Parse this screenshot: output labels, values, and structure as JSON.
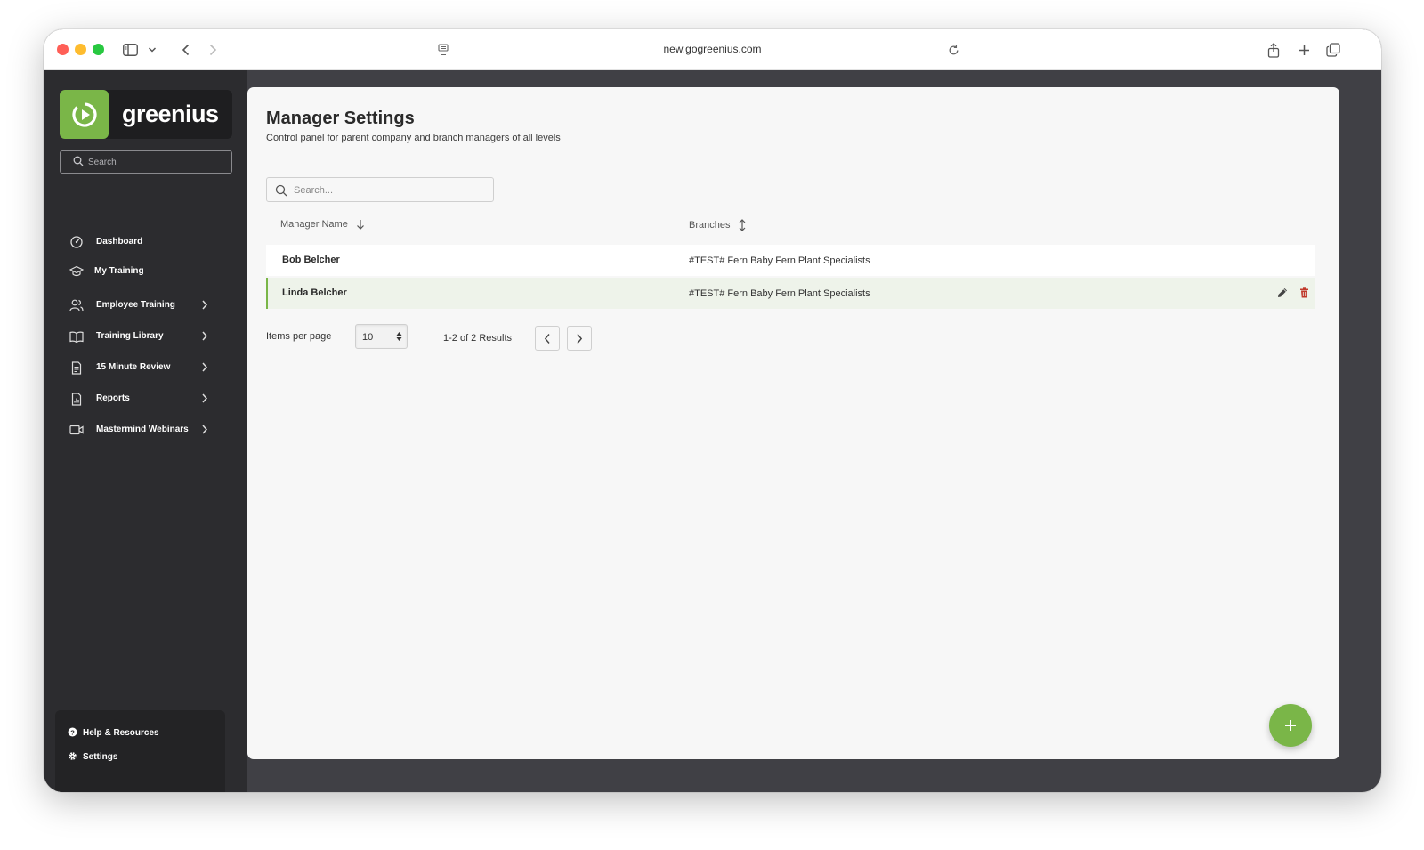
{
  "browser": {
    "url": "new.gogreenius.com"
  },
  "sidebar": {
    "logo_text": "greenius",
    "search_placeholder": "Search",
    "nav": [
      {
        "label": "Dashboard",
        "icon": "dashboard-icon",
        "has_chevron": false
      },
      {
        "label": "My Training",
        "icon": "graduation-cap-icon",
        "has_chevron": false
      },
      {
        "label": "Employee Training",
        "icon": "users-icon",
        "has_chevron": true
      },
      {
        "label": "Training Library",
        "icon": "book-icon",
        "has_chevron": true
      },
      {
        "label": "15 Minute Review",
        "icon": "document-icon",
        "has_chevron": true
      },
      {
        "label": "Reports",
        "icon": "report-icon",
        "has_chevron": true
      },
      {
        "label": "Mastermind Webinars",
        "icon": "video-icon",
        "has_chevron": true
      }
    ],
    "bottom": [
      {
        "label": "Help & Resources",
        "icon": "help-icon"
      },
      {
        "label": "Settings",
        "icon": "gear-icon"
      }
    ]
  },
  "main": {
    "title": "Manager Settings",
    "subtitle": "Control panel for parent company and branch managers of all levels",
    "search_placeholder": "Search...",
    "columns": {
      "manager_name": "Manager Name",
      "branches": "Branches"
    },
    "rows": [
      {
        "name": "Bob Belcher",
        "branch": "#TEST# Fern Baby Fern Plant Specialists",
        "selected": false
      },
      {
        "name": "Linda Belcher",
        "branch": "#TEST# Fern Baby Fern Plant Specialists",
        "selected": true
      }
    ],
    "pagination": {
      "items_per_page_label": "Items per page",
      "items_per_page_value": "10",
      "results_text": "1-2 of 2 Results"
    }
  },
  "colors": {
    "brand_green": "#7ab648",
    "sidebar_bg": "#2c2c2f",
    "delete_red": "#c0392b"
  }
}
